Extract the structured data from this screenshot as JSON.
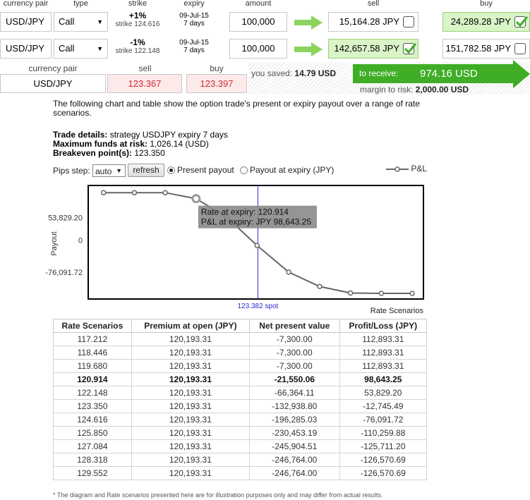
{
  "header": {
    "currency_pair": "currency pair",
    "type": "type",
    "strike": "strike",
    "expiry": "expiry",
    "amount": "amount",
    "sell": "sell",
    "buy": "buy"
  },
  "orders": [
    {
      "pair": "USD/JPY",
      "type": "Call",
      "pct": "+1%",
      "strike": "strike 124.616",
      "expiry_date": "09-Jul-15",
      "expiry_days": "7 days",
      "amount": "100,000",
      "sell": "15,164.28 JPY",
      "buy": "24,289.28 JPY",
      "sell_checked": false,
      "buy_checked": true
    },
    {
      "pair": "USD/JPY",
      "type": "Call",
      "pct": "-1%",
      "strike": "strike 122.148",
      "expiry_date": "09-Jul-15",
      "expiry_days": "7 days",
      "amount": "100,000",
      "sell": "142,657.58 JPY",
      "buy": "151,782.58 JPY",
      "sell_checked": true,
      "buy_checked": false
    }
  ],
  "spot": {
    "h_pair": "currency pair",
    "h_sell": "sell",
    "h_buy": "buy",
    "pair": "USD/JPY",
    "sell": "123.367",
    "buy": "123.397"
  },
  "summary": {
    "saved_label": "you saved:",
    "saved_value": "14.79 USD",
    "receive_label": "to receive:",
    "receive_value": "974.16 USD",
    "margin_label": "margin to risk:",
    "margin_value": "2,000.00 USD"
  },
  "description": "The following chart and table show the option trade's present or expiry payout over a range of rate scenarios.",
  "details": {
    "trade_label": "Trade details:",
    "trade_value": "strategy USDJPY expiry 7 days",
    "funds_label": "Maximum funds at risk:",
    "funds_value": "1,026.14 (USD)",
    "breakeven_label": "Breakeven point(s):",
    "breakeven_value": "123.350"
  },
  "controls": {
    "pips_label": "Pips step:",
    "pips_value": "auto",
    "refresh_label": "refresh",
    "present_label": "Present payout",
    "expiry_label": "Payout at expiry (JPY)",
    "present_selected": true,
    "legend_label": "P&L"
  },
  "chart_data": {
    "type": "line",
    "ylabel": "Payout",
    "xlabel": "Rate Scenarios",
    "ytick_labels": [
      "53,829.20",
      "0",
      "-76,091.72"
    ],
    "yticks": [
      53829.2,
      0,
      -76091.72
    ],
    "x": [
      117.212,
      118.446,
      119.68,
      120.914,
      122.148,
      123.35,
      124.616,
      125.85,
      127.084,
      128.318,
      129.552
    ],
    "series": [
      {
        "name": "P&L",
        "values": [
          112893.31,
          112893.31,
          112893.31,
          98643.25,
          53829.2,
          -12745.49,
          -76091.72,
          -110259.88,
          -125711.2,
          -126570.69,
          -126570.69
        ]
      }
    ],
    "spot_value": 123.382,
    "spot_label": "123.382 spot",
    "tooltip": {
      "line1": "Rate at expiry: 120.914",
      "line2": "P&L at expiry: JPY 98,643.25",
      "point_index": 3
    },
    "ylim": [
      -140000,
      130000
    ],
    "xlim": [
      116.6,
      130.0
    ]
  },
  "table": {
    "columns": [
      "Rate Scenarios",
      "Premium at open (JPY)",
      "Net present value",
      "Profit/Loss (JPY)"
    ],
    "rows": [
      [
        "117.212",
        "120,193.31",
        "-7,300.00",
        "112,893.31"
      ],
      [
        "118.446",
        "120,193.31",
        "-7,300.00",
        "112,893.31"
      ],
      [
        "119.680",
        "120,193.31",
        "-7,300.00",
        "112,893.31"
      ],
      [
        "120.914",
        "120,193.31",
        "-21,550.06",
        "98,643.25"
      ],
      [
        "122.148",
        "120,193.31",
        "-66,364.11",
        "53,829.20"
      ],
      [
        "123.350",
        "120,193.31",
        "-132,938.80",
        "-12,745.49"
      ],
      [
        "124.616",
        "120,193.31",
        "-196,285.03",
        "-76,091.72"
      ],
      [
        "125.850",
        "120,193.31",
        "-230,453.19",
        "-110,259.88"
      ],
      [
        "127.084",
        "120,193.31",
        "-245,904.51",
        "-125,711.20"
      ],
      [
        "128.318",
        "120,193.31",
        "-246,764.00",
        "-126,570.69"
      ],
      [
        "129.552",
        "120,193.31",
        "-246,764.00",
        "-126,570.69"
      ]
    ],
    "bold_row": 3
  },
  "footnote": "* The diagram and Rate scenarios presented here are for illustration purposes only and may differ from actual results.",
  "colors": {
    "accent_green": "#3fae26",
    "arrow_green": "#8cd45e",
    "highlight_bg": "#d9f4c7",
    "pink_bg": "#fce9e9",
    "price_red": "#d42a2a",
    "spot_line": "#2a2ad0",
    "tooltip_bg": "#8a8a8a"
  },
  "icons": {
    "arrow": "right-arrow-icon",
    "check": "checkmark-icon",
    "dropdown": "chevron-down-icon"
  }
}
